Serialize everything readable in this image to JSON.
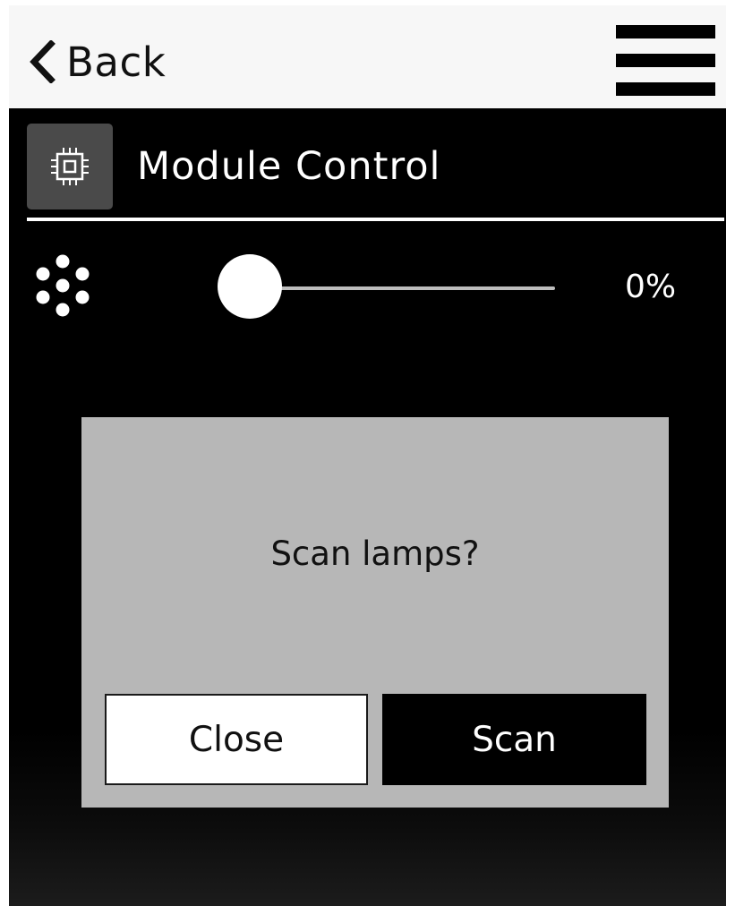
{
  "topbar": {
    "back_label": "Back",
    "back_icon": "chevron-left-icon",
    "menu_icon": "hamburger-menu-icon"
  },
  "module": {
    "title": "Module Control",
    "icon": "chip-icon"
  },
  "slider": {
    "icon": "dots-cluster-icon",
    "value_label": "0%",
    "value": 0
  },
  "dialog": {
    "message": "Scan lamps?",
    "close_label": "Close",
    "scan_label": "Scan"
  },
  "colors": {
    "background": "#000000",
    "topbar": "#f7f7f7",
    "dialog": "#b7b7b7",
    "icon_box": "#4a4a4a",
    "slider_track": "#bdbdbd"
  }
}
